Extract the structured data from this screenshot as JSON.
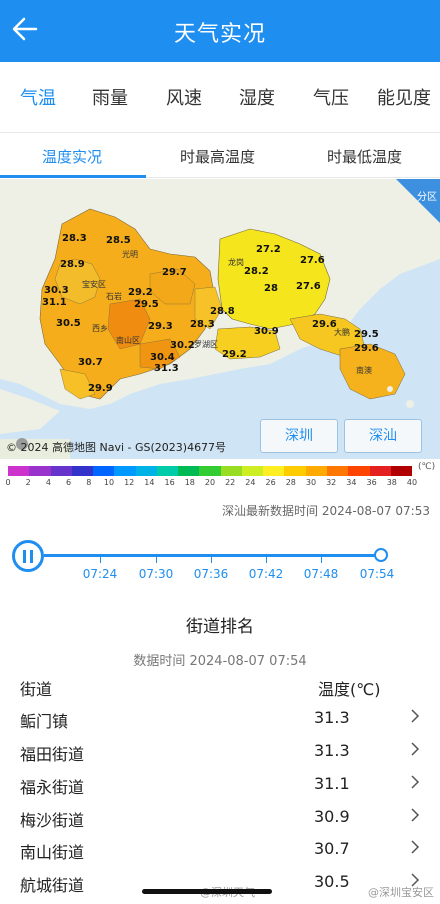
{
  "header": {
    "title": "天气实况"
  },
  "tabs_primary": [
    "气温",
    "雨量",
    "风速",
    "湿度",
    "气压",
    "能见度"
  ],
  "tabs_secondary": [
    "温度实况",
    "时最高温度",
    "时最低温度"
  ],
  "map": {
    "corner_label": "分区",
    "buttons": [
      "深圳",
      "深汕"
    ],
    "credit": "© 2024 高德地图 Navi - GS(2023)4677号",
    "temperatures": [
      "28.3",
      "28.5",
      "28.9",
      "30.3",
      "31.1",
      "29.2",
      "29.7",
      "29.5",
      "30.5",
      "29.3",
      "28.3",
      "28.8",
      "30.2",
      "30.4",
      "31.3",
      "30.7",
      "29.9",
      "27.2",
      "28.2",
      "28",
      "27.6",
      "27.6",
      "30.9",
      "29.6",
      "29.2",
      "29.5",
      "29.6"
    ],
    "districts": [
      "光明",
      "石岩",
      "西乡",
      "南山区",
      "龙岗",
      "罗湖区",
      "大鹏",
      "南澳",
      "宝安区"
    ]
  },
  "legend": {
    "unit": "(℃)",
    "colors": [
      "#cc33cc",
      "#9933cc",
      "#6633cc",
      "#3333cc",
      "#0066ff",
      "#0099ff",
      "#00b3e6",
      "#00ccaa",
      "#00bb55",
      "#33cc33",
      "#99dd22",
      "#ccee22",
      "#ffee22",
      "#ffcc00",
      "#ffaa00",
      "#ff7700",
      "#ff4400",
      "#e52020",
      "#b00000"
    ],
    "labels": [
      "0",
      "2",
      "4",
      "6",
      "8",
      "10",
      "12",
      "14",
      "16",
      "18",
      "20",
      "22",
      "24",
      "26",
      "28",
      "30",
      "32",
      "34",
      "36",
      "38",
      "40"
    ]
  },
  "update_time": "深汕最新数据时间 2024-08-07 07:53",
  "timeline": {
    "labels": [
      "07:24",
      "07:30",
      "07:36",
      "07:42",
      "07:48",
      "07:54"
    ]
  },
  "ranking": {
    "title": "街道排名",
    "data_time": "数据时间 2024-08-07 07:54",
    "col_street": "街道",
    "col_temp": "温度(℃)",
    "rows": [
      {
        "name": "鲘门镇",
        "temp": "31.3"
      },
      {
        "name": "福田街道",
        "temp": "31.3"
      },
      {
        "name": "福永街道",
        "temp": "31.1"
      },
      {
        "name": "梅沙街道",
        "temp": "30.9"
      },
      {
        "name": "南山街道",
        "temp": "30.7"
      },
      {
        "name": "航城街道",
        "temp": "30.5"
      }
    ]
  },
  "watermark_left": "@深圳天气",
  "watermark_right": "@深圳宝安区"
}
